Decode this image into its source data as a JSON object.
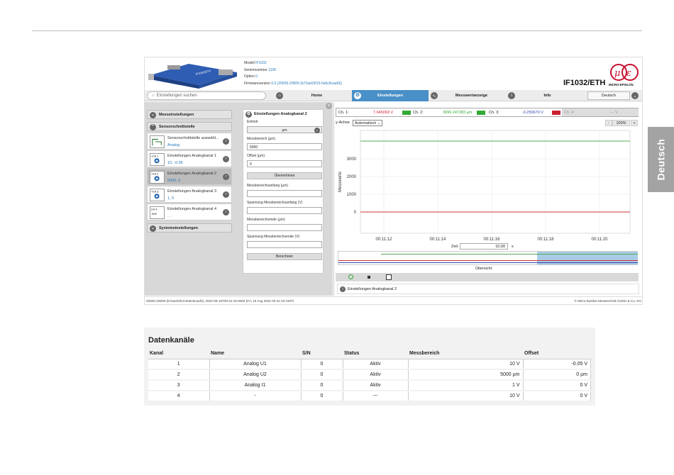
{
  "side_tab": "Deutsch",
  "header": {
    "model_label": "Modell",
    "model_value": "IF1032",
    "serial_label": "Seriennummer",
    "serial_value": "1108",
    "option_label": "Option",
    "option_value": "0",
    "firmware_label": "Firmwareversion",
    "firmware_value": "0.0 (20605-20609 (b72ae03f13-6a5c8caaf3))",
    "product": "IF1032/ETH",
    "logo_text": "MICRO-EPSILON"
  },
  "nav": {
    "search_placeholder": "Einstellungen suchen",
    "home": "Home",
    "settings": "Einstellungen",
    "values": "Messwertanzeige",
    "info": "Info",
    "language": "Deutsch"
  },
  "left_menu": {
    "measure_settings": "Messeinstellungen",
    "sensor_interface": "Sensorschnittstelle",
    "items": [
      {
        "title": "Sensorschnittstelle auswähl...",
        "sub": "Analog"
      },
      {
        "title": "Einstellungen Analogkanal 1",
        "sub": "10, -0.05"
      },
      {
        "title": "Einstellungen Analogkanal 2",
        "sub": "5000, 0"
      },
      {
        "title": "Einstellungen Analogkanal 3",
        "sub": "1, 0"
      },
      {
        "title": "Einstellungen Analogkanal 4",
        "sub": "..."
      }
    ],
    "system_settings": "Systemeinstellungen"
  },
  "form": {
    "title": "Einstellungen Analogkanal 2",
    "unit_label": "Einheit",
    "unit_value": "µm",
    "range_label": "Messbereich (µm)",
    "range_value": "5000",
    "offset_label": "Offset (µm)",
    "offset_value": "0",
    "apply": "Übernehmen",
    "range_start_label": "Messbereichsanfang (µm)",
    "voltage_start_label": "Spannung Messbereichsanfang (V)",
    "range_end_label": "Messbereichsende (µm)",
    "voltage_end_label": "Spannung Messbereichsende (V)",
    "calculate": "Berechnen"
  },
  "channels": [
    {
      "name": "Ch. 1:",
      "value": "7.645093 V",
      "color": "#cc2233"
    },
    {
      "name": "Ch. 2:",
      "value": "3999.247283 µm",
      "color": "#33aa33"
    },
    {
      "name": "Ch. 3:",
      "value": "-0.250679 V",
      "color": "#3344aa"
    },
    {
      "name": "Ch. 4:",
      "value": "--- V",
      "color": "#aaaaaa"
    }
  ],
  "chart_tools": {
    "yaxis_label": "y-Achse",
    "yaxis_value": "Automatisch",
    "zoom": "100%",
    "plus": "+",
    "minus": "-",
    "time_label": "Zeit",
    "time_value": "10,00",
    "time_unit": "s",
    "overview": "Übersicht"
  },
  "chart_data": {
    "type": "line",
    "ylabel": "Messwerte",
    "yticks": [
      "3000",
      "2000",
      "1000",
      "0"
    ],
    "xticks": [
      "00:11:12",
      "00:11:14",
      "00:11:16",
      "00:11:18",
      "00:11:20"
    ],
    "ylim": [
      -1200,
      4600
    ],
    "series": [
      {
        "color": "#55aa55",
        "values": [
          3999,
          3999
        ]
      },
      {
        "color": "#cc3333",
        "values": [
          0,
          0
        ]
      }
    ]
  },
  "status_text": "Einstellungen Analogkanal 2",
  "footer": {
    "left": "20605-20609 (b72ae03f13-6a5c8caaf3), 2022-08-15T00:41:19.006Z (Fri, 19 Aug 2022 00:41:19 GMT)",
    "right": "© Micro-Epsilon Messtechnik GmbH & Co. KG"
  },
  "table": {
    "title": "Datenkanäle",
    "headers": [
      "Kanal",
      "Name",
      "S/N",
      "Status",
      "Messbereich",
      "Offset"
    ],
    "rows": [
      [
        "1",
        "Analog U1",
        "0",
        "Aktiv",
        "10 V",
        "-0.05 V"
      ],
      [
        "2",
        "Analog U2",
        "0",
        "Aktiv",
        "5000 µm",
        "0 µm"
      ],
      [
        "3",
        "Analog I1",
        "0",
        "Aktiv",
        "1 V",
        "0 V"
      ],
      [
        "4",
        "-",
        "0",
        "---",
        "10 V",
        "0 V"
      ]
    ]
  }
}
